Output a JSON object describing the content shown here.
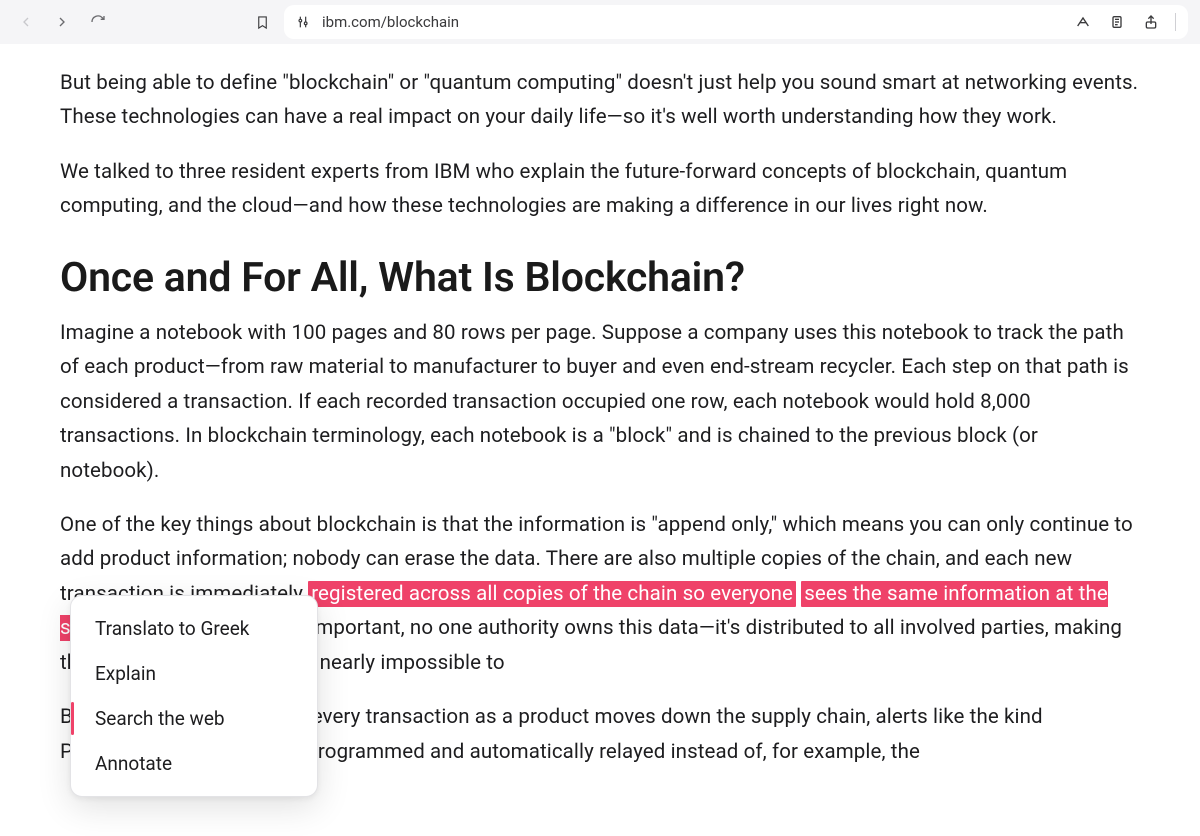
{
  "toolbar": {
    "url": "ibm.com/blockchain"
  },
  "article": {
    "p1": "But being able to define \"blockchain\" or \"quantum computing\" doesn't just help you sound smart at networking events. These technologies can have a real impact on your daily life—so it's well worth understanding how they work.",
    "p2": "We talked to three resident experts from IBM who explain the future-forward concepts of blockchain, quantum computing, and the cloud—and how these technologies are making a difference in our lives right now.",
    "h2": "Once and For All, What Is Blockchain?",
    "p3": "Imagine a notebook with 100 pages and 80 rows per page. Suppose a company uses this notebook to track the path of each product—from raw material to manufacturer to buyer and even end-stream recycler. Each step on that path is considered a transaction. If each recorded transaction occupied one row, each notebook would hold 8,000 transactions. In blockchain terminology, each notebook is a \"block\" and is chained to the previous block (or notebook).",
    "p4_pre": "One of the key things about blockchain is that the information is \"append only,\" which means you can only continue to add product information; nobody can erase the data. There are also multiple copies of the chain, and each new transaction is immediately ",
    "p4_hi1": "registered across all copies of the chain so everyone",
    "p4_mid": " ",
    "p4_hi2": "sees the same information at the same time.",
    "p4_post": " And equally as important, no one authority owns this data—it's distributed to all involved parties, making the records transparent and nearly impossible to",
    "p5": "Because blockchain stores every transaction as a product moves down the supply chain, alerts like the kind Parzygnat received can be programmed and automatically relayed instead of, for example, the"
  },
  "contextMenu": {
    "items": [
      {
        "label": "Translato to Greek"
      },
      {
        "label": "Explain"
      },
      {
        "label": "Search the web"
      },
      {
        "label": "Annotate"
      }
    ],
    "activeIndex": 2
  }
}
